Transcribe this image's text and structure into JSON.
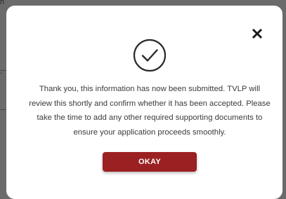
{
  "background": {
    "partial_text": "h"
  },
  "modal": {
    "message": "Thank you, this information has now been submitted. TVLP will review this shortly and confirm whether it has been accepted. Please take the time to add any other required supporting documents to ensure your application proceeds smoothly.",
    "ok_label": "OKAY",
    "icons": {
      "close": "close-icon",
      "success": "check-circle-icon"
    }
  },
  "colors": {
    "backdrop": "#6b6b6b",
    "modal_bg": "#ffffff",
    "accent": "#9b2021",
    "text": "#3a3a3a",
    "icon": "#1a1a1a"
  }
}
